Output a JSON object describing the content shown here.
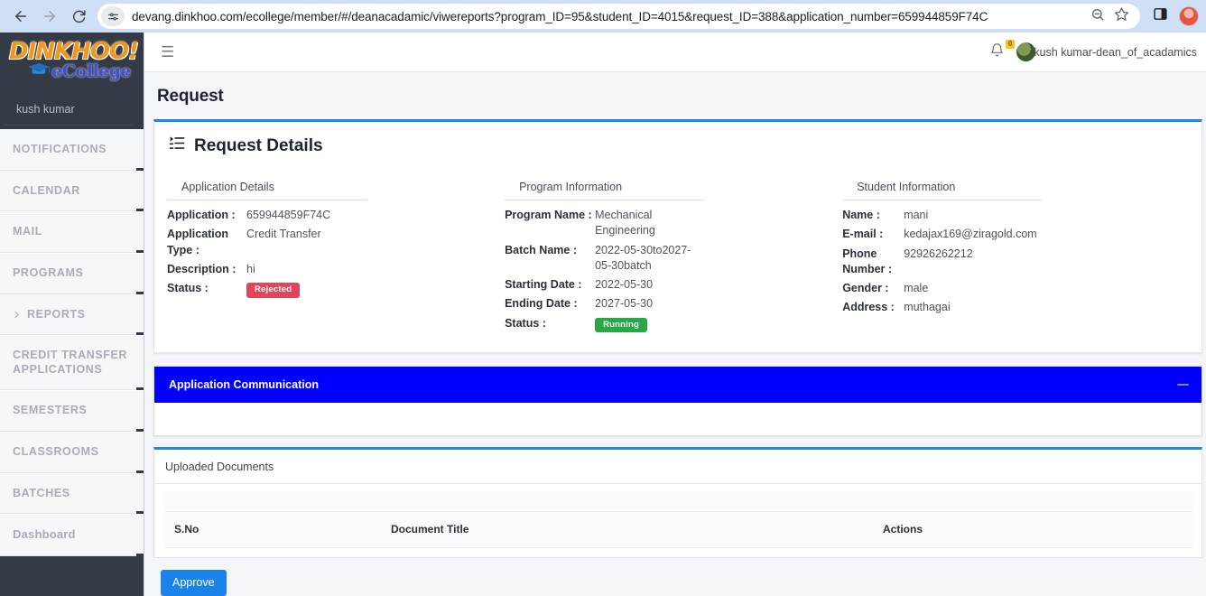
{
  "browser": {
    "url": "devang.dinkhoo.com/ecollege/member/#/deanacadamic/viwereports?program_ID=95&student_ID=4015&request_ID=388&application_number=659944859F74C",
    "back_icon": "back-arrow-icon",
    "forward_icon": "forward-arrow-icon",
    "reload_icon": "reload-icon",
    "site_info_icon": "site-settings-icon",
    "zoom_icon": "zoom-icon",
    "bookmark_icon": "star-icon",
    "side_panel_icon": "side-panel-icon",
    "profile_icon": "profile-avatar-icon"
  },
  "sidebar": {
    "logo_primary": "DINKHOO!",
    "logo_secondary": "eCollege",
    "user": "kush kumar",
    "items": [
      {
        "label": "NOTIFICATIONS",
        "has_caret": false
      },
      {
        "label": "CALENDAR",
        "has_caret": false
      },
      {
        "label": "MAIL",
        "has_caret": false
      },
      {
        "label": "PROGRAMS",
        "has_caret": false
      },
      {
        "label": "REPORTS",
        "has_caret": true
      },
      {
        "label": "CREDIT TRANSFER APPLICATIONS",
        "has_caret": false
      },
      {
        "label": "SEMESTERS",
        "has_caret": false
      },
      {
        "label": "CLASSROOMS",
        "has_caret": false
      },
      {
        "label": "BATCHES",
        "has_caret": false
      },
      {
        "label": "Dashboard",
        "has_caret": false
      }
    ]
  },
  "topbar": {
    "menu_icon": "hamburger-icon",
    "bell_icon": "bell-icon",
    "bell_count": "0",
    "user_name": "kush kumar-dean_of_acadamics"
  },
  "page": {
    "title": "Request"
  },
  "details": {
    "heading": "Request Details",
    "heading_icon": "list-details-icon",
    "application": {
      "title": "Application Details",
      "rows": [
        {
          "key": "Application :",
          "value": "659944859F74C",
          "type": "text"
        },
        {
          "key": "Application Type :",
          "value": "Credit Transfer",
          "type": "text"
        },
        {
          "key": "Description :",
          "value": "hi",
          "type": "text"
        },
        {
          "key": "Status :",
          "value": "Rejected",
          "type": "badge",
          "badge_class": "rejected",
          "badge_color": "#e2445c"
        }
      ]
    },
    "program": {
      "title": "Program Information",
      "rows": [
        {
          "key": "Program Name :",
          "value": "Mechanical Engineering",
          "type": "text"
        },
        {
          "key": "Batch Name :",
          "value": "2022-05-30to2027-05-30batch",
          "type": "text"
        },
        {
          "key": "Starting Date :",
          "value": "2022-05-30",
          "type": "text"
        },
        {
          "key": "Ending Date :",
          "value": "2027-05-30",
          "type": "text"
        },
        {
          "key": "Status :",
          "value": "Running",
          "type": "badge",
          "badge_class": "running",
          "badge_color": "#28a745"
        }
      ]
    },
    "student": {
      "title": "Student Information",
      "rows": [
        {
          "key": "Name :",
          "value": "mani",
          "type": "text"
        },
        {
          "key": "E-mail :",
          "value": "kedajax169@ziragold.com",
          "type": "text"
        },
        {
          "key": "Phone Number :",
          "value": "92926262212",
          "type": "text"
        },
        {
          "key": "Gender :",
          "value": "male",
          "type": "text"
        },
        {
          "key": "Address :",
          "value": "muthagai",
          "type": "text"
        }
      ]
    }
  },
  "communication": {
    "title": "Application Communication",
    "collapse_icon": "minus-collapse-icon",
    "header_color": "#0000ff"
  },
  "documents": {
    "title": "Uploaded Documents",
    "columns": [
      "S.No",
      "Document Title",
      "Actions"
    ],
    "rows": []
  },
  "footer": {
    "approve_label": "Approve",
    "approve_color": "#1a82eb"
  }
}
